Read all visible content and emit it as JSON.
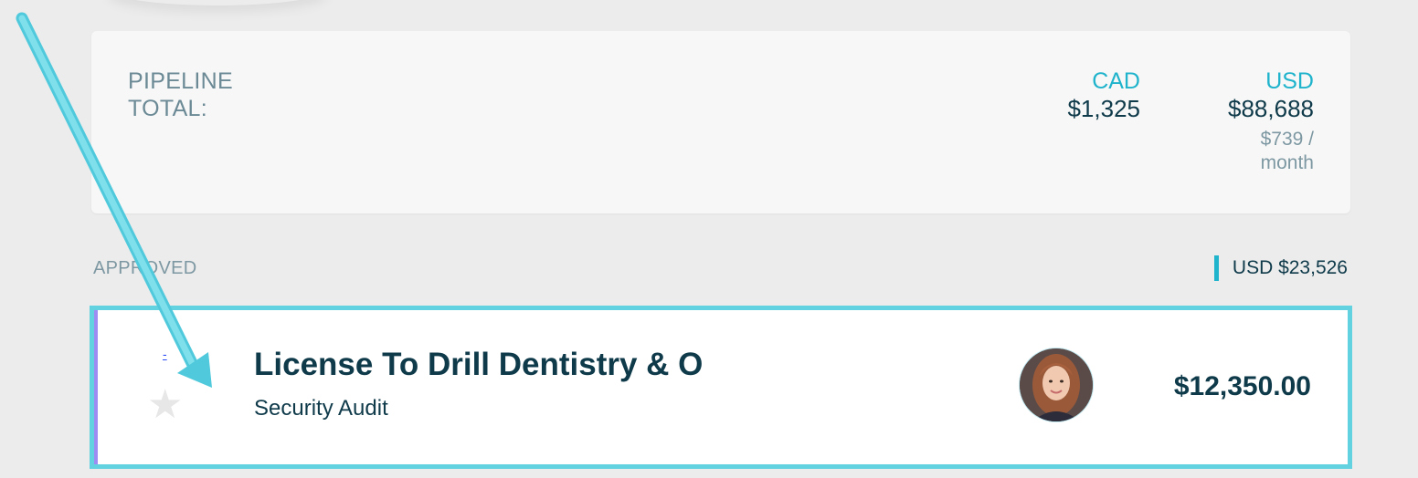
{
  "pipeline": {
    "label": "PIPELINE TOTAL:",
    "currencies": [
      {
        "code": "CAD",
        "amount": "$1,325",
        "sub": ""
      },
      {
        "code": "USD",
        "amount": "$88,688",
        "sub": "$739 / month"
      }
    ]
  },
  "section": {
    "label": "APPROVED",
    "total": "USD $23,526"
  },
  "deal": {
    "link_text": "-",
    "title": "License To Drill Dentistry & O",
    "subtitle": "Security Audit",
    "amount": "$12,350.00",
    "star_icon": "star-icon",
    "avatar_icon": "user-avatar"
  },
  "colors": {
    "accent": "#1fb3cc",
    "highlight_border": "#62d2e0",
    "text_dark": "#0f3a4a",
    "text_muted": "#7d98a2",
    "card_strip": "#9d8cf2"
  }
}
